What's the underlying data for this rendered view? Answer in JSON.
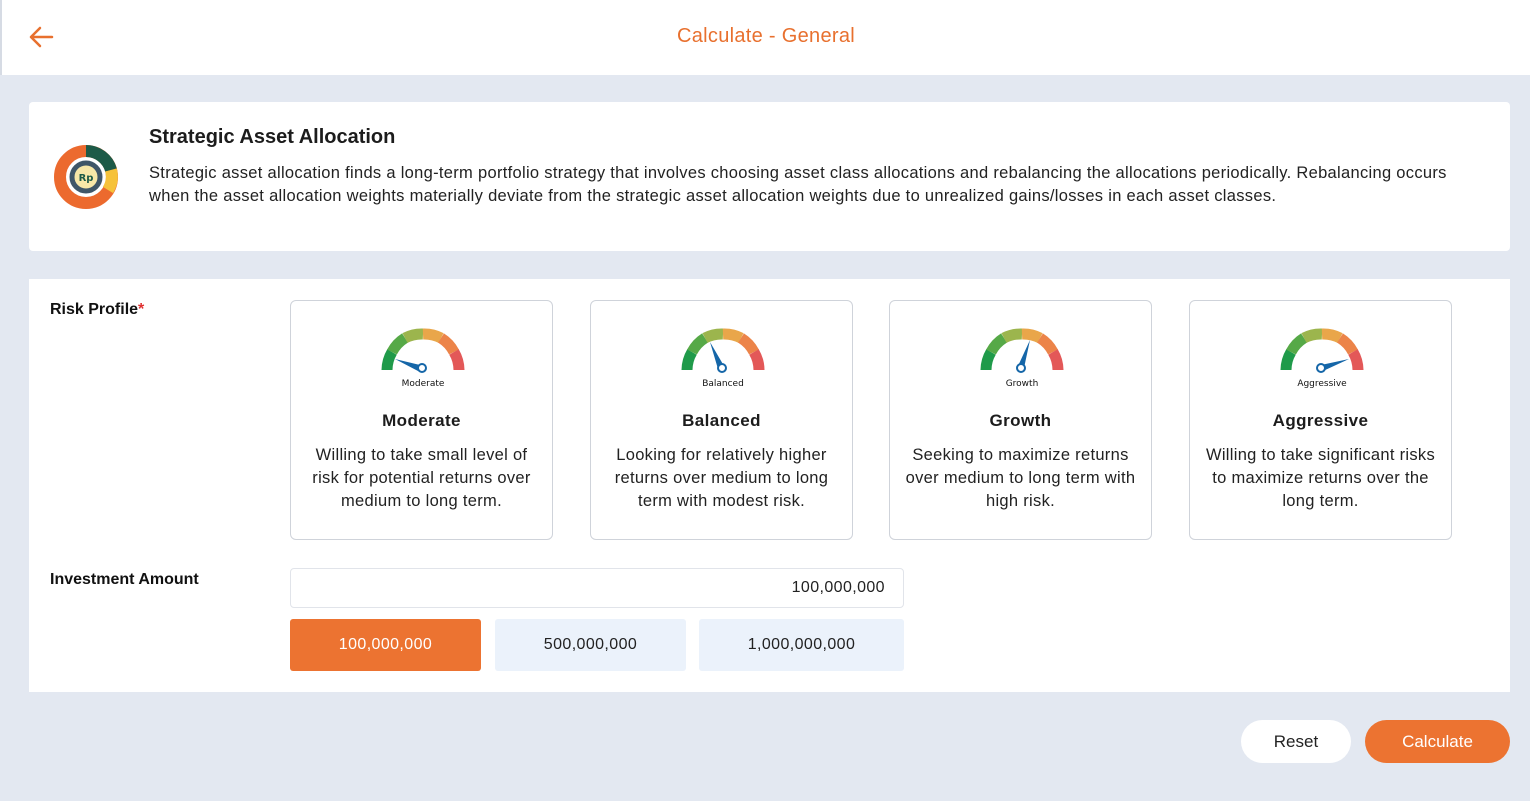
{
  "header": {
    "title": "Calculate - General",
    "back_icon": "arrow-left-icon"
  },
  "info": {
    "title": "Strategic Asset Allocation",
    "description": "Strategic asset allocation finds a long-term portfolio strategy that involves choosing asset class allocations and rebalancing the allocations periodically. Rebalancing occurs when the asset allocation weights materially deviate from the strategic asset allocation weights due to unrealized gains/losses in each asset classes.",
    "logo_text": "Rp"
  },
  "risk": {
    "label": "Risk Profile",
    "required_mark": "*",
    "profiles": [
      {
        "gauge_label": "Moderate",
        "name": "Moderate",
        "description": "Willing to take small level of risk for potential returns over medium to long term."
      },
      {
        "gauge_label": "Balanced",
        "name": "Balanced",
        "description": "Looking for relatively higher returns over medium to long term with modest risk."
      },
      {
        "gauge_label": "Growth",
        "name": "Growth",
        "description": "Seeking to maximize returns over medium to long term with high risk."
      },
      {
        "gauge_label": "Aggressive",
        "name": "Aggressive",
        "description": "Willing to take significant risks to maximize returns over the long term."
      }
    ]
  },
  "investment": {
    "label": "Investment Amount",
    "value": "100,000,000",
    "quick_amounts": [
      "100,000,000",
      "500,000,000",
      "1,000,000,000"
    ],
    "selected": "100,000,000"
  },
  "actions": {
    "reset": "Reset",
    "calculate": "Calculate"
  },
  "colors": {
    "accent": "#ec7331",
    "title": "#e8702e",
    "gauge_needle": "#1566a8",
    "quick_bg": "#ebf2fb"
  }
}
